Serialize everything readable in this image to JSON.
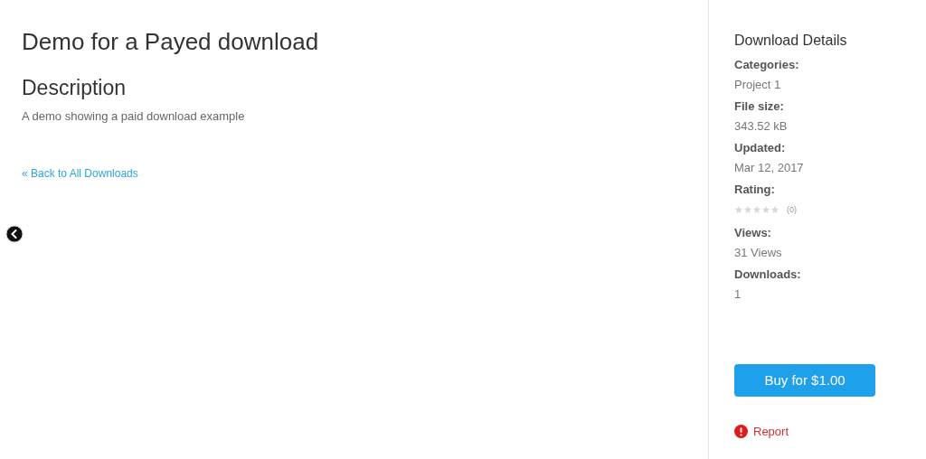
{
  "main": {
    "title": "Demo for a Payed download",
    "section_heading": "Description",
    "description": "A demo showing a paid download example",
    "back_link": "« Back to All Downloads"
  },
  "sidebar": {
    "heading": "Download Details",
    "details": [
      {
        "kind": "text",
        "label": "Categories:",
        "value": "Project 1"
      },
      {
        "kind": "text",
        "label": "File size:",
        "value": "343.52 kB"
      },
      {
        "kind": "text",
        "label": "Updated:",
        "value": "Mar 12, 2017"
      },
      {
        "kind": "rating",
        "label": "Rating:",
        "stars": 0,
        "count": "(0)"
      },
      {
        "kind": "text",
        "label": "Views:",
        "value": "31 Views"
      },
      {
        "kind": "text",
        "label": "Downloads:",
        "value": "1"
      }
    ],
    "buy_button": "Buy for $1.00",
    "report_link": "Report"
  }
}
